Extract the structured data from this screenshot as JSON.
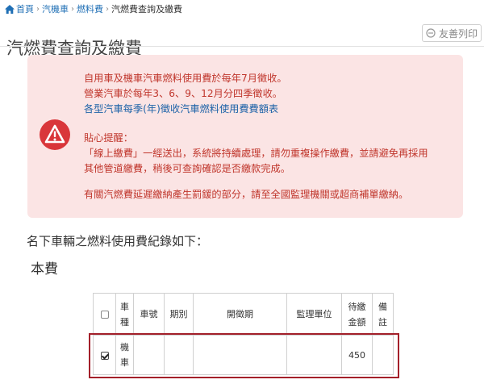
{
  "breadcrumb": {
    "items": [
      "首頁",
      "汽機車",
      "燃料費",
      "汽燃費查詢及繳費"
    ]
  },
  "header": {
    "title": "汽燃費查詢及繳費",
    "print_label": "友善列印"
  },
  "alert": {
    "lines1": [
      "自用車及機車汽車燃料使用費於每年7月徵收。",
      "營業汽車於每年3、6、9、12月分四季徵收。"
    ],
    "link": "各型汽車每季(年)徵收汽車燃料使用費費額表",
    "reminder_title": "貼心提醒：",
    "reminder_lines": [
      "「線上繳費」一經送出，系統將持續處理，請勿重複操作繳費，並請避免再採用",
      "其他管道繳費，稍後可查詢確認是否繳款完成。"
    ],
    "penalty": "有關汽燃費延遲繳納產生罰鍰的部分，請至全國監理機關或超商補單繳納。"
  },
  "intro": "名下車輛之燃料使用費紀錄如下：",
  "section_title": "本費",
  "table": {
    "headers": [
      "車種",
      "車號",
      "期別",
      "開徵期",
      "監理單位",
      "待繳金額",
      "備註"
    ],
    "rows": [
      {
        "checked": true,
        "type": "機車",
        "plate": "",
        "period": "",
        "levy": "",
        "office": "",
        "amount": "450",
        "note": ""
      }
    ]
  },
  "colors": {
    "alert_bg": "#fbe4e4",
    "alert_text": "#c0362c",
    "link": "#1e63a8",
    "highlight": "#a3202a"
  }
}
